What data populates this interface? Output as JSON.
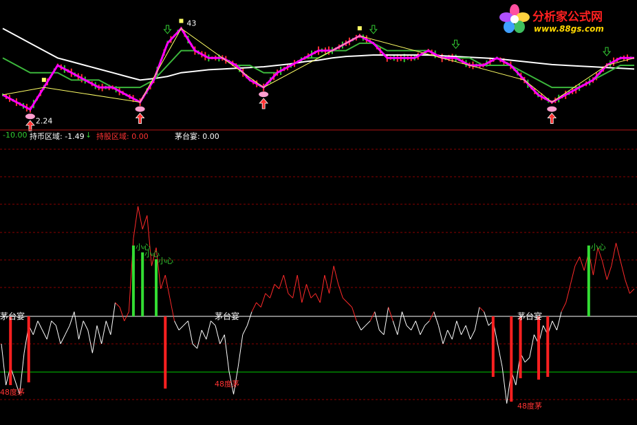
{
  "colors": {
    "background": "#000000",
    "price_line": "#ff00ff",
    "ma_short": "#3cb83c",
    "ma_long": "#ffffff",
    "zigzag": "#ffff66",
    "candle_up": "#ff3333",
    "candle_down": "#33cc33",
    "osc_up": "#ff2a2a",
    "osc_down": "#ffffff",
    "bar_sell": "#ff2020",
    "bar_warn": "#33dd33",
    "grid": "#8b0000",
    "divider": "#b41414",
    "baseline_mid": "#ffffff",
    "baseline_low": "#00cc00",
    "label_green": "#33cc33",
    "label_red": "#ff3333",
    "label_white": "#ffffff",
    "label_magenta": "#ff3333",
    "logo_red": "#ff2020",
    "logo_blue": "#3366ff"
  },
  "price_panel": {
    "high_label": "43",
    "low_label": "2.24",
    "markers_up_icon": "red-arrow-up-icon",
    "markers_down_icon": "green-arrow-down-icon"
  },
  "legend": {
    "value1": "-10.00",
    "label2": "持币区域: -1.49",
    "arrow": "↓",
    "label3": "持股区域: 0.00",
    "label4": "茅台宴: 0.00"
  },
  "osc_labels": {
    "event": "茅台宴",
    "low": "48度茅",
    "warn": "小心"
  },
  "logo": {
    "title": "分析家公式网",
    "url": "www.88gs.com"
  },
  "chart_data": [
    {
      "type": "line",
      "name": "price",
      "title": "",
      "x": [
        0,
        1,
        2,
        3,
        4,
        5,
        6,
        7,
        8,
        9,
        10,
        11,
        12,
        13,
        14,
        15,
        16,
        17,
        18,
        19,
        20,
        21,
        22,
        23,
        24,
        25,
        26,
        27,
        28,
        29,
        30,
        31,
        32,
        33,
        34,
        35,
        36,
        37,
        38,
        39,
        40,
        41,
        42,
        43,
        44,
        45,
        46
      ],
      "series": [
        {
          "values": [
            2.5,
            2.4,
            2.3,
            2.6,
            2.9,
            2.8,
            2.7,
            2.6,
            2.6,
            2.5,
            2.4,
            2.7,
            3.2,
            3.4,
            3.1,
            3.0,
            3.0,
            2.9,
            2.7,
            2.6,
            2.8,
            2.9,
            3.0,
            3.1,
            3.1,
            3.2,
            3.3,
            3.2,
            3.0,
            3.0,
            3.0,
            3.1,
            3.0,
            3.0,
            2.9,
            2.9,
            3.0,
            2.9,
            2.7,
            2.5,
            2.4,
            2.5,
            2.6,
            2.7,
            2.9,
            3.0,
            3.0
          ]
        },
        {
          "values": [
            3.0,
            2.9,
            2.8,
            2.8,
            2.8,
            2.7,
            2.7,
            2.7,
            2.6,
            2.6,
            2.6,
            2.7,
            2.9,
            3.1,
            3.1,
            3.0,
            3.0,
            2.9,
            2.9,
            2.8,
            2.8,
            2.9,
            3.0,
            3.0,
            3.1,
            3.1,
            3.2,
            3.2,
            3.1,
            3.1,
            3.1,
            3.1,
            3.0,
            3.0,
            3.0,
            2.9,
            2.9,
            2.9,
            2.8,
            2.7,
            2.6,
            2.6,
            2.6,
            2.7,
            2.8,
            2.9,
            2.9
          ]
        },
        {
          "values": [
            3.4,
            3.3,
            3.2,
            3.1,
            3.0,
            2.95,
            2.9,
            2.85,
            2.8,
            2.75,
            2.7,
            2.72,
            2.75,
            2.8,
            2.82,
            2.84,
            2.85,
            2.86,
            2.87,
            2.88,
            2.9,
            2.92,
            2.95,
            2.97,
            3.0,
            3.02,
            3.03,
            3.04,
            3.04,
            3.04,
            3.04,
            3.04,
            3.03,
            3.02,
            3.01,
            3.0,
            2.99,
            2.97,
            2.95,
            2.93,
            2.91,
            2.9,
            2.89,
            2.88,
            2.87,
            2.86,
            2.85
          ]
        }
      ]
    },
    {
      "type": "line",
      "name": "oscillator",
      "title": "",
      "ylim": [
        -100,
        100
      ],
      "series": [
        {
          "values": [
            -30,
            -75,
            -55,
            -70,
            -85,
            -40,
            -10,
            -20,
            -5,
            -15,
            -25,
            -5,
            -10,
            -30,
            -20,
            -10,
            5,
            -25,
            -5,
            -15,
            -40,
            -10,
            -30,
            -5,
            -20,
            15,
            10,
            -5,
            5,
            85,
            120,
            95,
            110,
            55,
            75,
            30,
            45,
            20,
            -5,
            -15,
            -10,
            -5,
            -30,
            -35,
            -15,
            -25,
            -5,
            -10,
            -30,
            -20,
            -60,
            -85,
            -55,
            -20,
            -10,
            5,
            15,
            10,
            25,
            20,
            35,
            30,
            45,
            25,
            20,
            45,
            15,
            35,
            20,
            25,
            15,
            45,
            25,
            55,
            35,
            20,
            15,
            10,
            -5,
            -15,
            -10,
            -5,
            5,
            -15,
            -20,
            10,
            -5,
            -20,
            5,
            -10,
            -15,
            -5,
            -20,
            -10,
            -5,
            5,
            -10,
            -30,
            -15,
            -25,
            -5,
            -20,
            -10,
            -25,
            -15,
            10,
            5,
            -10,
            -5,
            -30,
            -55,
            -95,
            -60,
            -75,
            -40,
            -50,
            -45,
            -20,
            -30,
            -10,
            -20,
            -5,
            -15,
            5,
            15,
            35,
            55,
            65,
            50,
            70,
            45,
            75,
            60,
            40,
            55,
            80,
            60,
            40,
            25,
            30
          ]
        }
      ]
    }
  ]
}
